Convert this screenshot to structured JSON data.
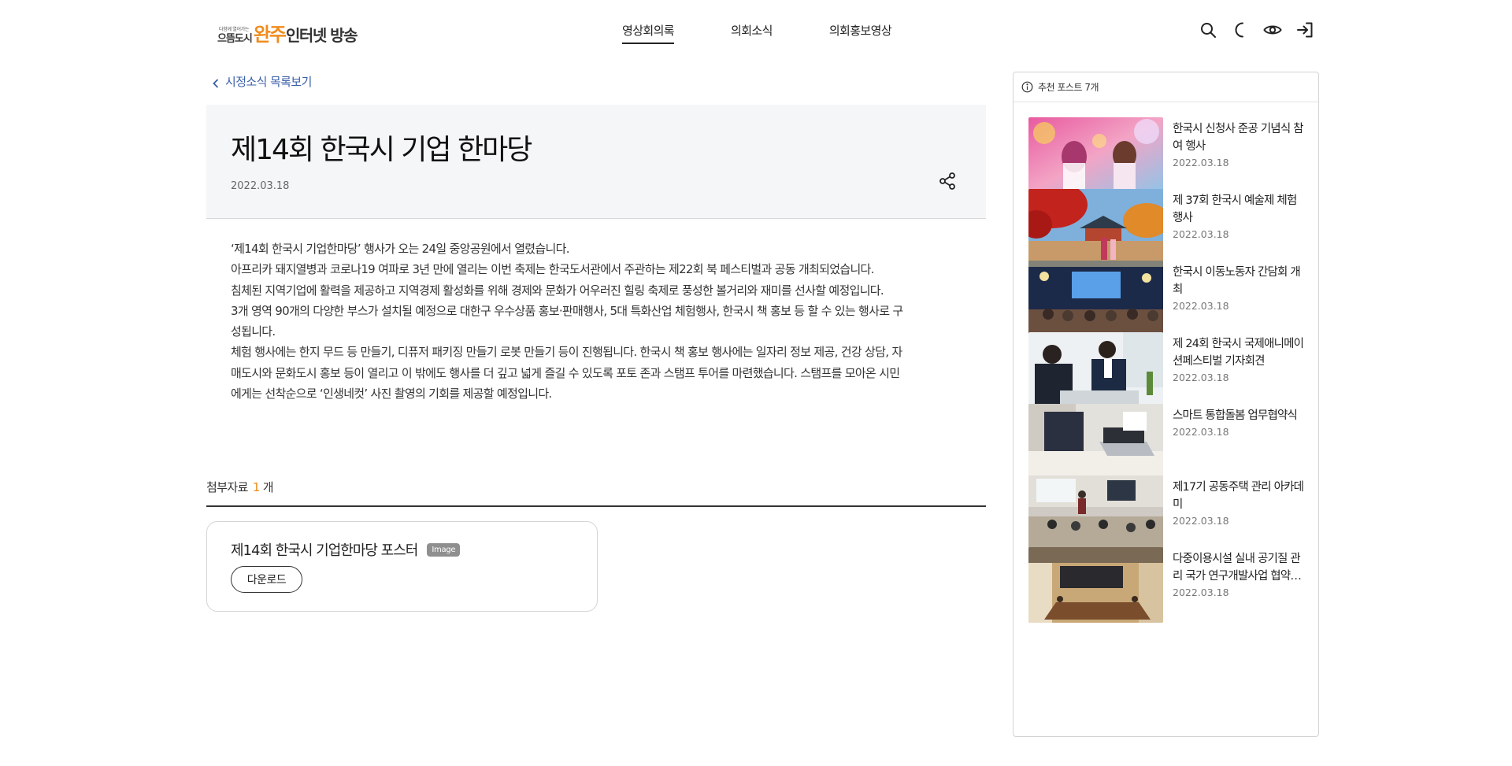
{
  "header": {
    "logo": {
      "tagline": "다함께 열어가는",
      "city": "으뜸도시",
      "name": "완주",
      "rest": "인터넷 방송"
    },
    "nav": [
      {
        "label": "영상회의록",
        "active": true
      },
      {
        "label": "의회소식",
        "active": false
      },
      {
        "label": "의회홍보영상",
        "active": false
      }
    ],
    "utility_icons": [
      "search-icon",
      "dark-mode-icon",
      "eye-icon",
      "login-icon"
    ]
  },
  "back_link": "시정소식 목록보기",
  "article": {
    "title": "제14회 한국시 기업 한마당",
    "date": "2022.03.18",
    "paragraphs": [
      "‘제14회 한국시 기업한마당’ 행사가 오는 24일 중앙공원에서 열렸습니다.",
      "아프리카 돼지열병과 코로나19 여파로 3년 만에 열리는 이번 축제는 한국도서관에서 주관하는 제22회 북 페스티벌과 공동 개최되었습니다.",
      "침체된 지역기업에 활력을 제공하고 지역경제 활성화를 위해 경제와 문화가 어우러진 힐링 축제로 풍성한 볼거리와 재미를 선사할 예정입니다.",
      "3개 영역 90개의 다양한 부스가 설치될 예정으로 대한구 우수상품 홍보·판매행사, 5대 특화산업 체험행사, 한국시 책 홍보 등 할 수 있는 행사로 구\n성됩니다.",
      "체험 행사에는 한지 무드 등 만들기, 디퓨저 패키징 만들기 로봇 만들기 등이 진행됩니다. 한국시 책 홍보 행사에는 일자리 정보 제공, 건강 상담, 자\n매도시와 문화도시 홍보 등이 열리고 이 밖에도 행사를 더 깊고 넓게 즐길 수 있도록 포토 존과 스탬프 투어를 마련했습니다. 스탬프를 모아온 시민\n에게는 선착순으로 ‘인생네컷’ 사진 촬영의 기회를 제공할 예정입니다."
    ]
  },
  "attachments": {
    "label": "첨부자료",
    "count": "1",
    "unit": "개",
    "files": [
      {
        "title": "제14회 한국시 기업한마당 포스터",
        "badge": "Image",
        "download": "다운로드"
      }
    ]
  },
  "sidebar": {
    "header": "추천 포스트 7개",
    "posts": [
      {
        "title": "한국시 신청사 준공 기념식 참여 행사",
        "date": "2022.03.18",
        "thumb": "festival-photo"
      },
      {
        "title": "제 37회 한국시 예술제 체험 행사",
        "date": "2022.03.18",
        "thumb": "palace-autumn-photo"
      },
      {
        "title": "한국시 이동노동자 간담회 개최",
        "date": "2022.03.18",
        "thumb": "conference-hall-photo"
      },
      {
        "title": "제 24회 한국시 국제애니메이션페스티벌 기자회견",
        "date": "2022.03.18",
        "thumb": "business-meeting-photo"
      },
      {
        "title": "스마트 통합돌봄 업무협약식",
        "date": "2022.03.18",
        "thumb": "laptop-meeting-photo"
      },
      {
        "title": "제17기 공동주택 관리 아카데미",
        "date": "2022.03.18",
        "thumb": "seminar-room-photo"
      },
      {
        "title": "다중이용시설 실내 공기질 관리 국가 연구개발사업 협약…",
        "date": "2022.03.18",
        "thumb": "meeting-room-photo"
      }
    ]
  },
  "colors": {
    "accent": "#f08c1e",
    "link": "#3a5fa8",
    "title_bg": "#f5f6f8"
  }
}
